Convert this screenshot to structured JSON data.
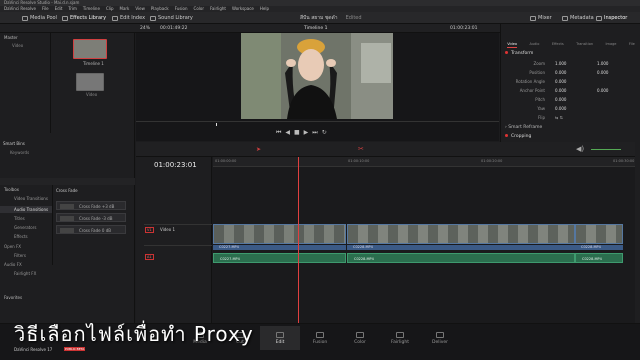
{
  "window": {
    "title": "DaVinci Resolve Studio - Mai.d.n.sjam"
  },
  "menu": [
    "DaVinci Resolve",
    "File",
    "Edit",
    "Trim",
    "Timeline",
    "Clip",
    "Mark",
    "View",
    "Playback",
    "Fusion",
    "Color",
    "Fairlight",
    "Workspace",
    "Help"
  ],
  "toolbar": {
    "media_pool": "Media Pool",
    "effects_library": "Effects Library",
    "edit_index": "Edit Index",
    "sound_library": "Sound Library",
    "project_name": "สีปัน สยาม ชุดดำ",
    "project_status": "Edited",
    "timecode_top": "01:00:23:01",
    "timeline_top": "Timeline - C0227.MP4",
    "mixer": "Mixer",
    "metadata": "Metadata",
    "inspector": "Inspector"
  },
  "subtool": {
    "zoom": "24%",
    "timecode": "00:01:49:22",
    "timeline_name": "Timeline 1"
  },
  "bins": {
    "master": "Master",
    "video": "Video"
  },
  "clips": [
    {
      "label": "Timeline 1"
    },
    {
      "label": "Video"
    }
  ],
  "smart_bins": {
    "title": "Smart Bins",
    "keywords": "Keywords"
  },
  "effects": {
    "toolbox": "Toolbox",
    "items": [
      "Video Transitions",
      "Audio Transitions",
      "Titles",
      "Generators",
      "Effects"
    ],
    "open_fx": "Open FX",
    "filters": "Filters",
    "audio_fx": "Audio FX",
    "fairlight_fx": "Fairlight FX",
    "favorites": "Favorites",
    "cross_fade_header": "Cross Fade",
    "cross_fades": [
      "Cross Fade +3 dB",
      "Cross Fade -3 dB",
      "Cross Fade 0 dB"
    ]
  },
  "inspector": {
    "tabs": [
      "Video",
      "Audio",
      "Effects",
      "Transition",
      "Image",
      "File"
    ],
    "transform": "Transform",
    "zoom_label": "Zoom",
    "zoom_x": "1.000",
    "zoom_y": "1.000",
    "position_label": "Position",
    "pos_x": "0.000",
    "pos_y": "0.000",
    "rotation_label": "Rotation Angle",
    "rotation": "0.000",
    "anchor_label": "Anchor Point",
    "anchor_x": "0.000",
    "anchor_y": "0.000",
    "pitch_label": "Pitch",
    "pitch": "0.000",
    "yaw_label": "Yaw",
    "yaw": "0.000",
    "flip_label": "Flip",
    "smart_reframe": "Smart Reframe",
    "cropping": "Cropping"
  },
  "timeline": {
    "timecode": "01:00:23:01",
    "ruler": [
      "01:00:00:00",
      "01:00:10:00",
      "01:00:20:00",
      "01:00:30:00"
    ],
    "video_track": "Video 1",
    "track_v": "V1",
    "track_a": "A1",
    "clips_video": [
      "C0227.MP4",
      "C0228.MP4",
      "C0228.MP4"
    ],
    "clips_audio": [
      "C0227.MP4",
      "C0228.MP4",
      "C0228.MP4"
    ]
  },
  "pages": [
    "Media",
    "Cut",
    "Edit",
    "Fusion",
    "Color",
    "Fairlight",
    "Deliver"
  ],
  "app_label": "DaVinci Resolve 17",
  "app_badge": "PUBLIC BETA",
  "caption": "วิธีเลือกไฟล์เพื่อทำ Proxy"
}
